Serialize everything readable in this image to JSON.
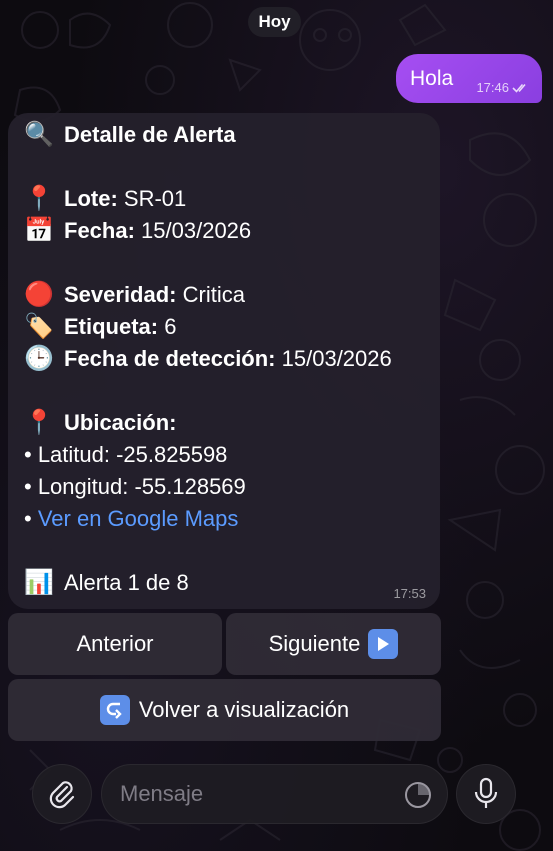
{
  "date_divider": "Hoy",
  "outgoing_message": {
    "text": "Hola",
    "time": "17:46"
  },
  "alert": {
    "title": "Detalle de Alerta",
    "lote_label": "Lote:",
    "lote_value": "SR-01",
    "fecha_label": "Fecha:",
    "fecha_value": "15/03/2026",
    "severidad_label": "Severidad:",
    "severidad_value": "Critica",
    "etiqueta_label": "Etiqueta:",
    "etiqueta_value": "6",
    "deteccion_label": "Fecha de detección:",
    "deteccion_value": "15/03/2026",
    "ubicacion_label": "Ubicación:",
    "latitud": "• Latitud: -25.825598",
    "longitud": "• Longitud: -55.128569",
    "bullet": "•",
    "maps_link": "Ver en Google Maps",
    "counter": "Alerta 1 de 8",
    "time": "17:53",
    "icons": [
      "search-icon",
      "pin-icon",
      "calendar-icon",
      "red-circle-icon",
      "tag-icon",
      "clock-icon",
      "pin-icon",
      "bar-chart-icon"
    ]
  },
  "keyboard": {
    "prev_label": "Anterior",
    "next_label": "Siguiente",
    "back_label": "Volver a visualización"
  },
  "composer": {
    "placeholder": "Mensaje"
  },
  "colors": {
    "outgoing_bubble": "#9c47ee",
    "link": "#5b9bff",
    "button_icon": "#5d8ee8"
  }
}
